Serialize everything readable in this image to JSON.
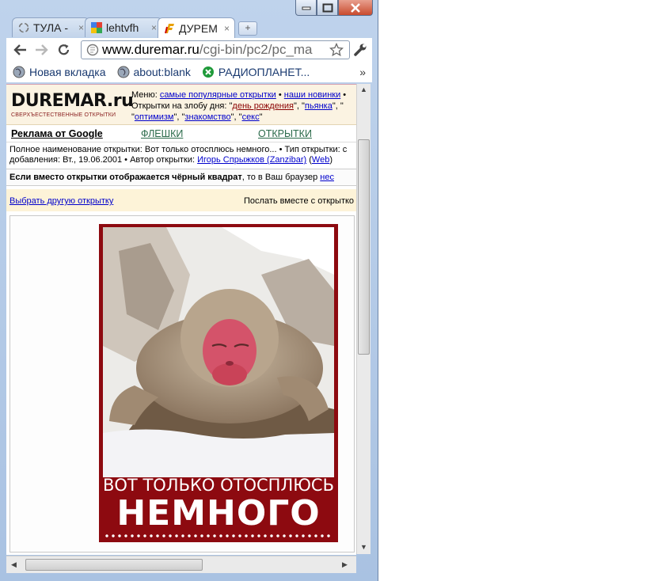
{
  "browser": {
    "tabs": [
      {
        "label": "ТУЛА -",
        "icon": "loading-icon"
      },
      {
        "label": "lehtvfh",
        "icon": "google-icon"
      },
      {
        "label": "ДУРЕМ",
        "icon": "duremar-favicon",
        "active": true
      }
    ],
    "tab_close": "×",
    "new_tab": "+",
    "url_host": "www.duremar.ru",
    "url_path": "/cgi-bin/pc2/pc_ma",
    "bookmarks": [
      {
        "label": "Новая вкладка",
        "icon": "globe-icon"
      },
      {
        "label": "about:blank",
        "icon": "globe-icon"
      },
      {
        "label": "РАДИОПЛАНЕТ...",
        "icon": "radioplanet-icon"
      }
    ],
    "bookmarks_more": "»"
  },
  "site": {
    "logo": "DUREMAR.ru",
    "logo_sub": "СВЕРХЪЕСТЕСТВЕННЫЕ ОТКРЫТКИ",
    "menu_label": "Меню:",
    "menu_popular": "самые популярные открытки",
    "menu_sep": "•",
    "menu_new": "наши новинки",
    "menu_more": "•",
    "topics_label": "Открытки на злобу дня: \"",
    "topic_birthday": "день рождения",
    "topic_sep1": "\", \"",
    "topic_drunk": "пьянка",
    "topic_tail1": "\", \"",
    "topic_optimism": "оптимизм",
    "topic_sep2": "\", \"",
    "topic_dating": "знакомство",
    "topic_sep3": "\", \"",
    "topic_sex": "секс",
    "topic_end": "\"",
    "nav_ads": "Реклама от Google",
    "nav_flash": "ФЛЕШКИ",
    "nav_cards": "ОТКРЫТКИ",
    "info_line1": "Полное наименование открытки: Вот только отосплюсь немного... • Тип открытки: с",
    "info_line2_prefix": "добавления: Вт., 19.06.2001 • Автор открытки: ",
    "info_author": "Игорь Спрыжков (Zanzibar)",
    "info_open": " (",
    "info_web": "Web",
    "info_close": ")",
    "warn_bold": "Если вместо открытки отображается чёрный квадрат",
    "warn_rest": ", то в Ваш браузер ",
    "warn_link": "нес",
    "pick_link": "Выбрать другую открытку",
    "send_text": "Послать вместе с открытко",
    "card_line1": "ВОТ ТОЛЬКО ОТОСПЛЮСЬ",
    "card_line2": "НЕМНОГО"
  },
  "colors": {
    "card_bg": "#8d0a10",
    "header_bg": "#fbf3e2",
    "link": "#0000cc"
  }
}
